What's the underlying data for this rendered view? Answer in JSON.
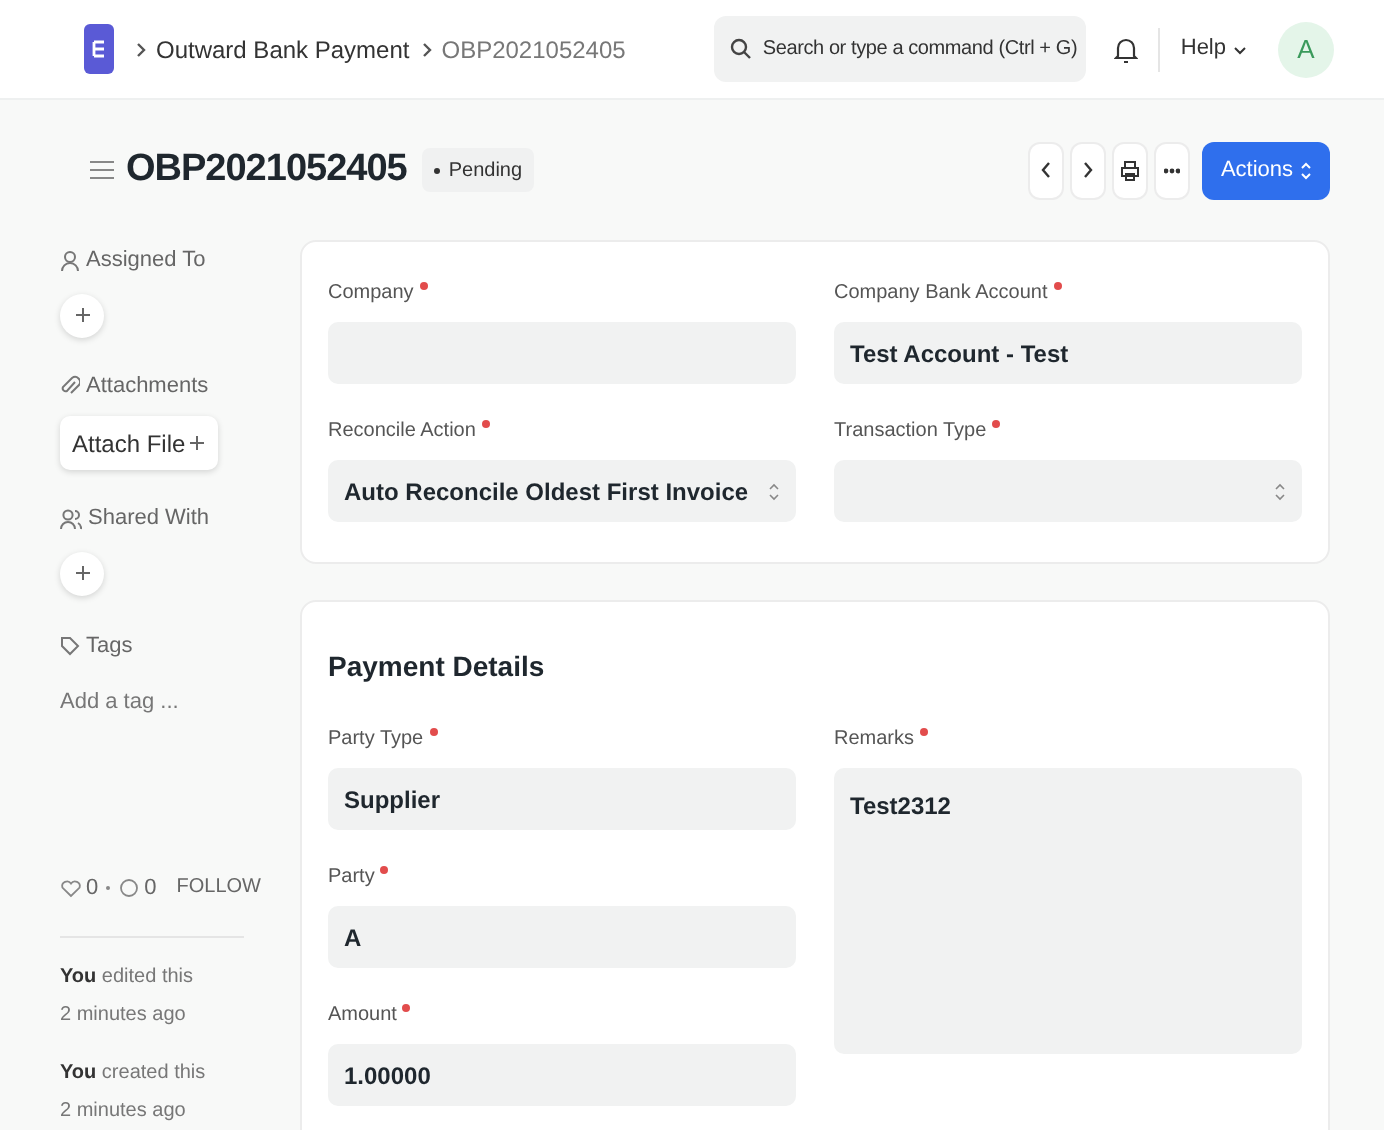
{
  "navbar": {
    "breadcrumbs": [
      "Outward Bank Payment",
      "OBP2021052405"
    ],
    "search": {
      "placeholder": "Search or type a command (Ctrl + G)"
    },
    "help": "Help",
    "avatar": "A"
  },
  "page": {
    "title": "OBP2021052405",
    "status": "Pending",
    "actions": "Actions"
  },
  "sidebar": {
    "assigned_to": "Assigned To",
    "attachments": "Attachments",
    "attach_file": "Attach File",
    "shared_with": "Shared With",
    "tags": "Tags",
    "add_tag": "Add a tag ...",
    "likes": "0",
    "comments": "0",
    "follow": "FOLLOW",
    "activity": [
      {
        "text": "**You** edited this",
        "time": "2 minutes ago"
      },
      {
        "text": "**You** created this",
        "time": "2 minutes ago"
      }
    ]
  },
  "sections": [
    {
      "columns": [
        [
          {
            "label": "Company",
            "required": true,
            "kind": "text"
          },
          {
            "label": "Reconcile Action",
            "required": true,
            "kind": "select",
            "value": "Auto Reconcile Oldest First Invoice"
          }
        ],
        [
          {
            "label": "Company Bank Account",
            "required": true,
            "kind": "text",
            "value": "Test Account - Test"
          },
          {
            "label": "Transaction Type",
            "required": true,
            "kind": "select"
          }
        ]
      ]
    },
    {
      "title": "Payment Details",
      "columns": [
        [
          {
            "label": "Party Type",
            "required": true,
            "kind": "text",
            "value": "Supplier"
          },
          {
            "label": "Party",
            "required": true,
            "kind": "text",
            "value": "A"
          },
          {
            "label": "Amount",
            "required": true,
            "kind": "text",
            "value": "1.00000"
          }
        ],
        [
          {
            "label": "Remarks",
            "required": true,
            "kind": "textarea",
            "value": "Test2312"
          }
        ]
      ]
    }
  ]
}
